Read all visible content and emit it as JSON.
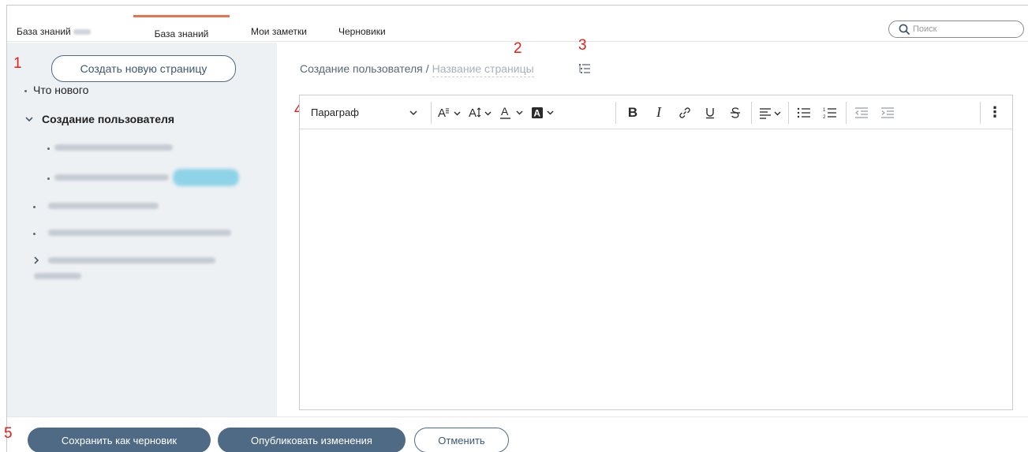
{
  "tabs": [
    {
      "label": "База знаний"
    },
    {
      "label": "База знаний"
    },
    {
      "label": "Мои заметки"
    },
    {
      "label": "Черновики"
    }
  ],
  "search": {
    "placeholder": "Поиск"
  },
  "markers": [
    "1",
    "2",
    "3",
    "4",
    "5"
  ],
  "sidebar": {
    "create_button": "Создать новую страницу",
    "items": [
      {
        "label": "Что нового"
      },
      {
        "label": "Создание пользователя"
      }
    ]
  },
  "breadcrumb": {
    "parent": "Создание пользователя",
    "separator": "/",
    "current": "Название страницы"
  },
  "toolbar": {
    "paragraph": "Параграф",
    "bold": "B",
    "italic": "I",
    "more": "⋮"
  },
  "footer": {
    "save_draft": "Сохранить как черновик",
    "publish": "Опубликовать изменения",
    "cancel": "Отменить"
  },
  "colors": {
    "accent_tab": "#e8734f",
    "primary_button": "#4e6a84",
    "marker": "#e3201b",
    "sidebar_bg": "#eef1f4"
  }
}
